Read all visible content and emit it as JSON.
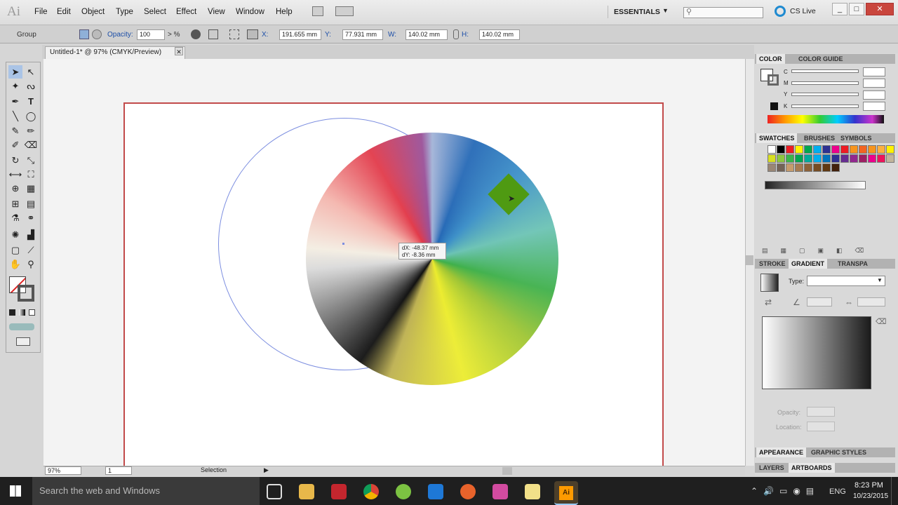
{
  "app": {
    "logo": "Ai"
  },
  "menu": [
    "File",
    "Edit",
    "Object",
    "Type",
    "Select",
    "Effect",
    "View",
    "Window",
    "Help"
  ],
  "workspace": {
    "label": "ESSENTIALS",
    "cslive": "CS Live"
  },
  "control_bar": {
    "group_label": "Group",
    "opacity_label": "Opacity:",
    "opacity_value": "100",
    "x_label": "X:",
    "x_value": "191.655 mm",
    "y_label": "Y:",
    "y_value": "77.931 mm",
    "w_label": "W:",
    "w_value": "140.02 mm",
    "h_label": "H:",
    "h_value": "140.02 mm"
  },
  "document": {
    "tab_title": "Untitled-1* @ 97% (CMYK/Preview)"
  },
  "canvas": {
    "tooltip_dx": "dX: -48.37 mm",
    "tooltip_dy": "dY: -8.36 mm"
  },
  "status": {
    "zoom": "97%",
    "page": "1",
    "tool": "Selection"
  },
  "panels": {
    "color_tabs": [
      "COLOR",
      "COLOR GUIDE"
    ],
    "cmyk_labels": [
      "C",
      "M",
      "Y",
      "K"
    ],
    "swatch_tabs": [
      "SWATCHES",
      "BRUSHES",
      "SYMBOLS"
    ],
    "gradient_tabs": [
      "STROKE",
      "GRADIENT",
      "TRANSPA"
    ],
    "type_label": "Type:",
    "opacity_label": "Opacity:",
    "location_label": "Location:",
    "appearance_tabs": [
      "APPEARANCE",
      "GRAPHIC STYLES"
    ],
    "layer_tabs": [
      "LAYERS",
      "ARTBOARDS"
    ],
    "swatch_colors": [
      "#ffffff",
      "#000000",
      "#ed1c24",
      "#fff200",
      "#00a651",
      "#00aeef",
      "#2e3192",
      "#ec008c",
      "#ed1c24",
      "#f7941d",
      "#f26522",
      "#f7941d",
      "#fbb040",
      "#fff200",
      "#d7df23",
      "#8dc63f",
      "#39b54a",
      "#00a651",
      "#00a99d",
      "#00aeef",
      "#0072bc",
      "#2e3192",
      "#662d91",
      "#92278f",
      "#9e1f63",
      "#ec008c",
      "#ed145b",
      "#c2b59b",
      "#998675",
      "#736357",
      "#c69c6d",
      "#a67c52",
      "#8c6239",
      "#754c24",
      "#603913",
      "#42210b"
    ]
  },
  "taskbar": {
    "search": "Search the web and Windows",
    "time": "8:23 PM",
    "date": "10/23/2015",
    "lang": "ENG"
  }
}
